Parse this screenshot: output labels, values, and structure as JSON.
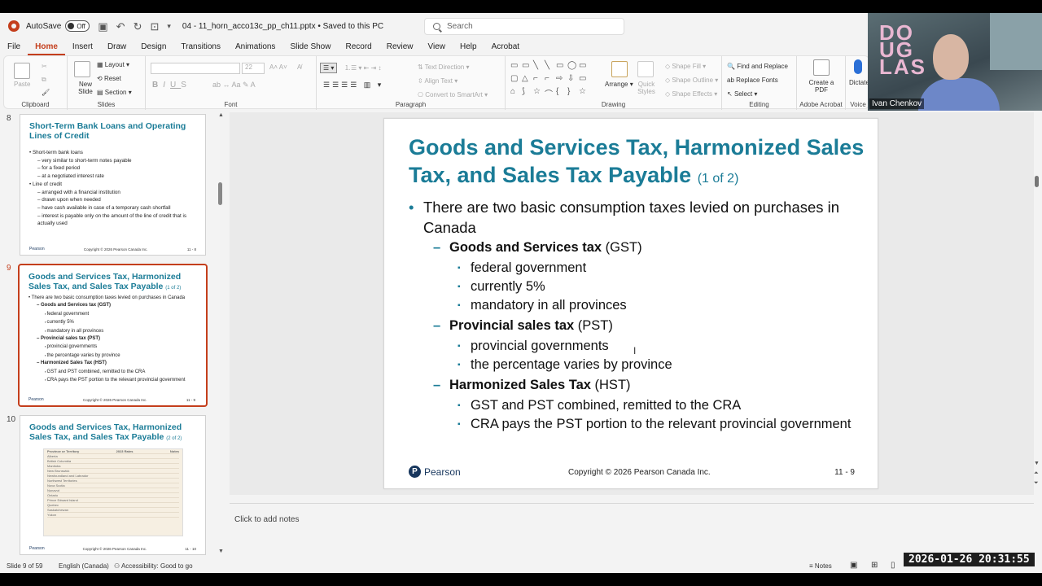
{
  "titlebar": {
    "autosave_label": "AutoSave",
    "autosave_state": "Off",
    "doc_title": "04 - 11_horn_acco13c_pp_ch11.pptx • Saved to this PC",
    "search_placeholder": "Search"
  },
  "menu": [
    "File",
    "Home",
    "Insert",
    "Draw",
    "Design",
    "Transitions",
    "Animations",
    "Slide Show",
    "Record",
    "Review",
    "View",
    "Help",
    "Acrobat"
  ],
  "ribbon": {
    "clipboard": {
      "label": "Clipboard",
      "paste": "Paste"
    },
    "slides": {
      "label": "Slides",
      "new_slide": "New Slide",
      "layout": "Layout",
      "reset": "Reset",
      "section": "Section"
    },
    "font": {
      "label": "Font",
      "size": "22"
    },
    "paragraph": {
      "label": "Paragraph",
      "text_direction": "Text Direction",
      "align_text": "Align Text",
      "convert_smartart": "Convert to SmartArt"
    },
    "drawing": {
      "label": "Drawing",
      "arrange": "Arrange",
      "quick_styles": "Quick Styles",
      "shape_fill": "Shape Fill",
      "shape_outline": "Shape Outline",
      "shape_effects": "Shape Effects"
    },
    "editing": {
      "label": "Editing",
      "find_replace": "Find and Replace",
      "replace_fonts": "Replace Fonts",
      "select": "Select"
    },
    "acrobat": {
      "label": "Adobe Acrobat",
      "create_pdf": "Create a PDF"
    },
    "voice": {
      "label": "Voice",
      "dictate": "Dictate"
    }
  },
  "video": {
    "name": "Ivan Chenkov",
    "logo": "DOUGLAS"
  },
  "thumbnails": [
    {
      "number": "8",
      "title": "Short-Term Bank Loans and Operating Lines of Credit",
      "lines": [
        {
          "level": 1,
          "text": "Short-term bank loans"
        },
        {
          "level": 2,
          "text": "very similar to short-term notes payable"
        },
        {
          "level": 2,
          "text": "for a fixed period"
        },
        {
          "level": 2,
          "text": "at a negotiated interest rate"
        },
        {
          "level": 1,
          "text": "Line of credit"
        },
        {
          "level": 2,
          "text": "arranged with a financial institution"
        },
        {
          "level": 2,
          "text": "drawn upon when needed"
        },
        {
          "level": 2,
          "text": "have cash available in case of a temporary cash shortfall"
        },
        {
          "level": 2,
          "text": "interest is payable only on the amount of the line of credit that is actually used"
        }
      ],
      "footer": {
        "logo": "Pearson",
        "copyright": "Copyright © 2026 Pearson Canada Inc.",
        "page": "11 - 8"
      }
    },
    {
      "number": "9",
      "title": "Goods and Services Tax, Harmonized Sales Tax, and Sales Tax Payable",
      "subtitle": "(1 of 2)",
      "lines": [
        {
          "level": 1,
          "text": "There are two basic consumption taxes levied on purchases in Canada"
        },
        {
          "level": 2,
          "text": "Goods and Services tax (GST)"
        },
        {
          "level": 3,
          "text": "federal government"
        },
        {
          "level": 3,
          "text": "currently 5%"
        },
        {
          "level": 3,
          "text": "mandatory in all provinces"
        },
        {
          "level": 2,
          "text": "Provincial sales tax (PST)"
        },
        {
          "level": 3,
          "text": "provincial governments"
        },
        {
          "level": 3,
          "text": "the percentage varies by province"
        },
        {
          "level": 2,
          "text": "Harmonized Sales Tax (HST)"
        },
        {
          "level": 3,
          "text": "GST and PST combined, remitted to the CRA"
        },
        {
          "level": 3,
          "text": "CRA pays the PST portion to the relevant provincial government"
        }
      ],
      "footer": {
        "logo": "Pearson",
        "copyright": "Copyright © 2026 Pearson Canada Inc.",
        "page": "11 - 9"
      }
    },
    {
      "number": "10",
      "title": "Goods and Services Tax, Harmonized Sales Tax, and Sales Tax Payable",
      "subtitle": "(2 of 2)",
      "table_header": [
        "Province or Territory",
        "2023 Rates",
        "Notes"
      ],
      "table_rows": [
        "Alberta",
        "British Columbia",
        "Manitoba",
        "New Brunswick",
        "Newfoundland and Labrador",
        "Northwest Territories",
        "Nova Scotia",
        "Nunavut",
        "Ontario",
        "Prince Edward Island",
        "Quebec",
        "Saskatchewan",
        "Yukon"
      ],
      "footer": {
        "logo": "Pearson",
        "copyright": "Copyright © 2026 Pearson Canada Inc.",
        "page": "11 - 10"
      }
    }
  ],
  "slide": {
    "title": "Goods and Services Tax, Harmonized Sales Tax, and Sales Tax Payable",
    "subtitle": "(1 of 2)",
    "intro": "There are two basic consumption taxes levied on purchases in Canada",
    "sections": [
      {
        "bold": "Goods and Services tax",
        "rest": " (GST)",
        "items": [
          "federal government",
          "currently 5%",
          "mandatory in all provinces"
        ]
      },
      {
        "bold": "Provincial sales tax",
        "rest": " (PST)",
        "items": [
          "provincial governments",
          "the percentage varies by province"
        ]
      },
      {
        "bold": "Harmonized Sales Tax",
        "rest": " (HST)",
        "items": [
          "GST and PST combined, remitted to the CRA",
          "CRA pays the PST portion to the relevant provincial government"
        ]
      }
    ],
    "footer": {
      "logo": "Pearson",
      "copyright": "Copyright © 2026 Pearson Canada Inc.",
      "page": "11 - 9"
    }
  },
  "notes_placeholder": "Click to add notes",
  "status": {
    "slide_count": "Slide 9 of 59",
    "language": "English (Canada)",
    "accessibility": "Accessibility: Good to go",
    "notes": "Notes"
  },
  "timestamp": "2026-01-26  20:31:55",
  "colors": {
    "accent": "#c43e1c",
    "title_teal": "#1b7c97",
    "pearson_blue": "#17365d"
  }
}
